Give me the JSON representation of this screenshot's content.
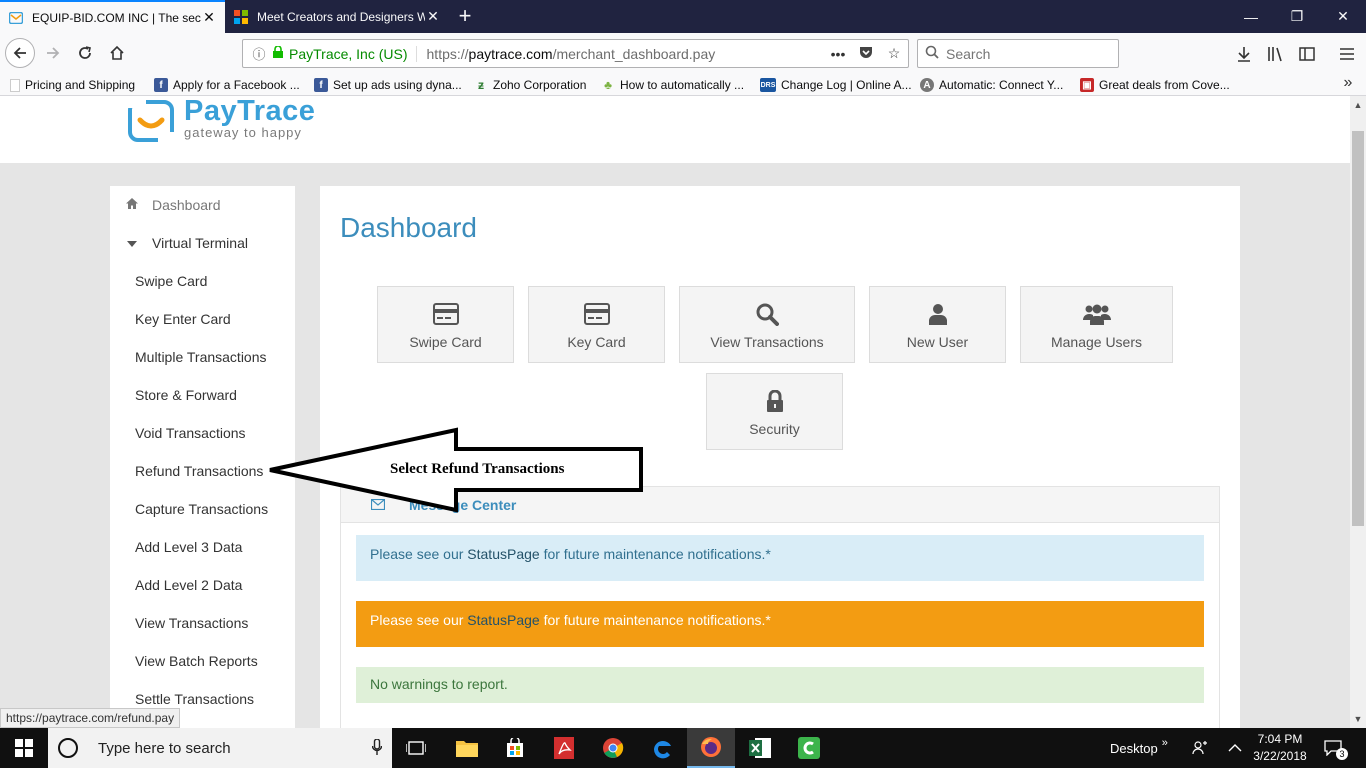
{
  "browser": {
    "tabs": [
      {
        "title": "EQUIP-BID.COM INC | The secu",
        "active": true
      },
      {
        "title": "Meet Creators and Designers W",
        "active": false
      }
    ],
    "url": {
      "identity": "PayTrace, Inc (US)",
      "prefix": "https://",
      "domain": "paytrace.com",
      "path": "/merchant_dashboard.pay"
    },
    "search_placeholder": "Search",
    "bookmarks": [
      {
        "label": "Pricing and Shipping",
        "icon": "page-icon"
      },
      {
        "label": "Apply for a Facebook ...",
        "icon": "facebook-icon"
      },
      {
        "label": "Set up ads using dyna...",
        "icon": "facebook-icon"
      },
      {
        "label": "Zoho Corporation",
        "icon": "zoho-icon"
      },
      {
        "label": "How to automatically ...",
        "icon": "leaf-icon"
      },
      {
        "label": "Change Log | Online A...",
        "icon": "drs-icon"
      },
      {
        "label": "Automatic: Connect Y...",
        "icon": "automatic-icon"
      },
      {
        "label": "Great deals from Cove...",
        "icon": "gift-icon"
      }
    ],
    "status_url": "https://paytrace.com/refund.pay"
  },
  "brand": {
    "name": "PayTrace",
    "tagline": "gateway to happy",
    "color": "#3aa0d8",
    "accent": "#f39c12"
  },
  "sidebar": {
    "dashboard": "Dashboard",
    "virtual_terminal": "Virtual Terminal",
    "items": [
      "Swipe Card",
      "Key Enter Card",
      "Multiple Transactions",
      "Store & Forward",
      "Void Transactions",
      "Refund Transactions",
      "Capture Transactions",
      "Add Level 3 Data",
      "Add Level 2 Data",
      "View Transactions",
      "View Batch Reports",
      "Settle Transactions"
    ]
  },
  "main": {
    "title": "Dashboard",
    "tiles": [
      {
        "label": "Swipe Card",
        "icon": "credit-card-icon"
      },
      {
        "label": "Key Card",
        "icon": "credit-card-icon"
      },
      {
        "label": "View Transactions",
        "icon": "search-icon"
      },
      {
        "label": "New User",
        "icon": "user-icon"
      },
      {
        "label": "Manage Users",
        "icon": "users-icon"
      },
      {
        "label": "Security",
        "icon": "lock-icon"
      }
    ],
    "message_center": {
      "title": "Message Center",
      "info": {
        "pre": "Please see our ",
        "link": "StatusPage",
        "post": " for future maintenance notifications.*"
      },
      "warning": {
        "pre": "Please see our ",
        "link": "StatusPage",
        "post": " for future maintenance notifications.*"
      },
      "success": "No warnings to report."
    }
  },
  "annotation": {
    "text": "Select Refund Transactions"
  },
  "taskbar": {
    "search_placeholder": "Type here to search",
    "desktop_label": "Desktop",
    "time": "7:04 PM",
    "date": "3/22/2018",
    "notification_count": "3"
  }
}
